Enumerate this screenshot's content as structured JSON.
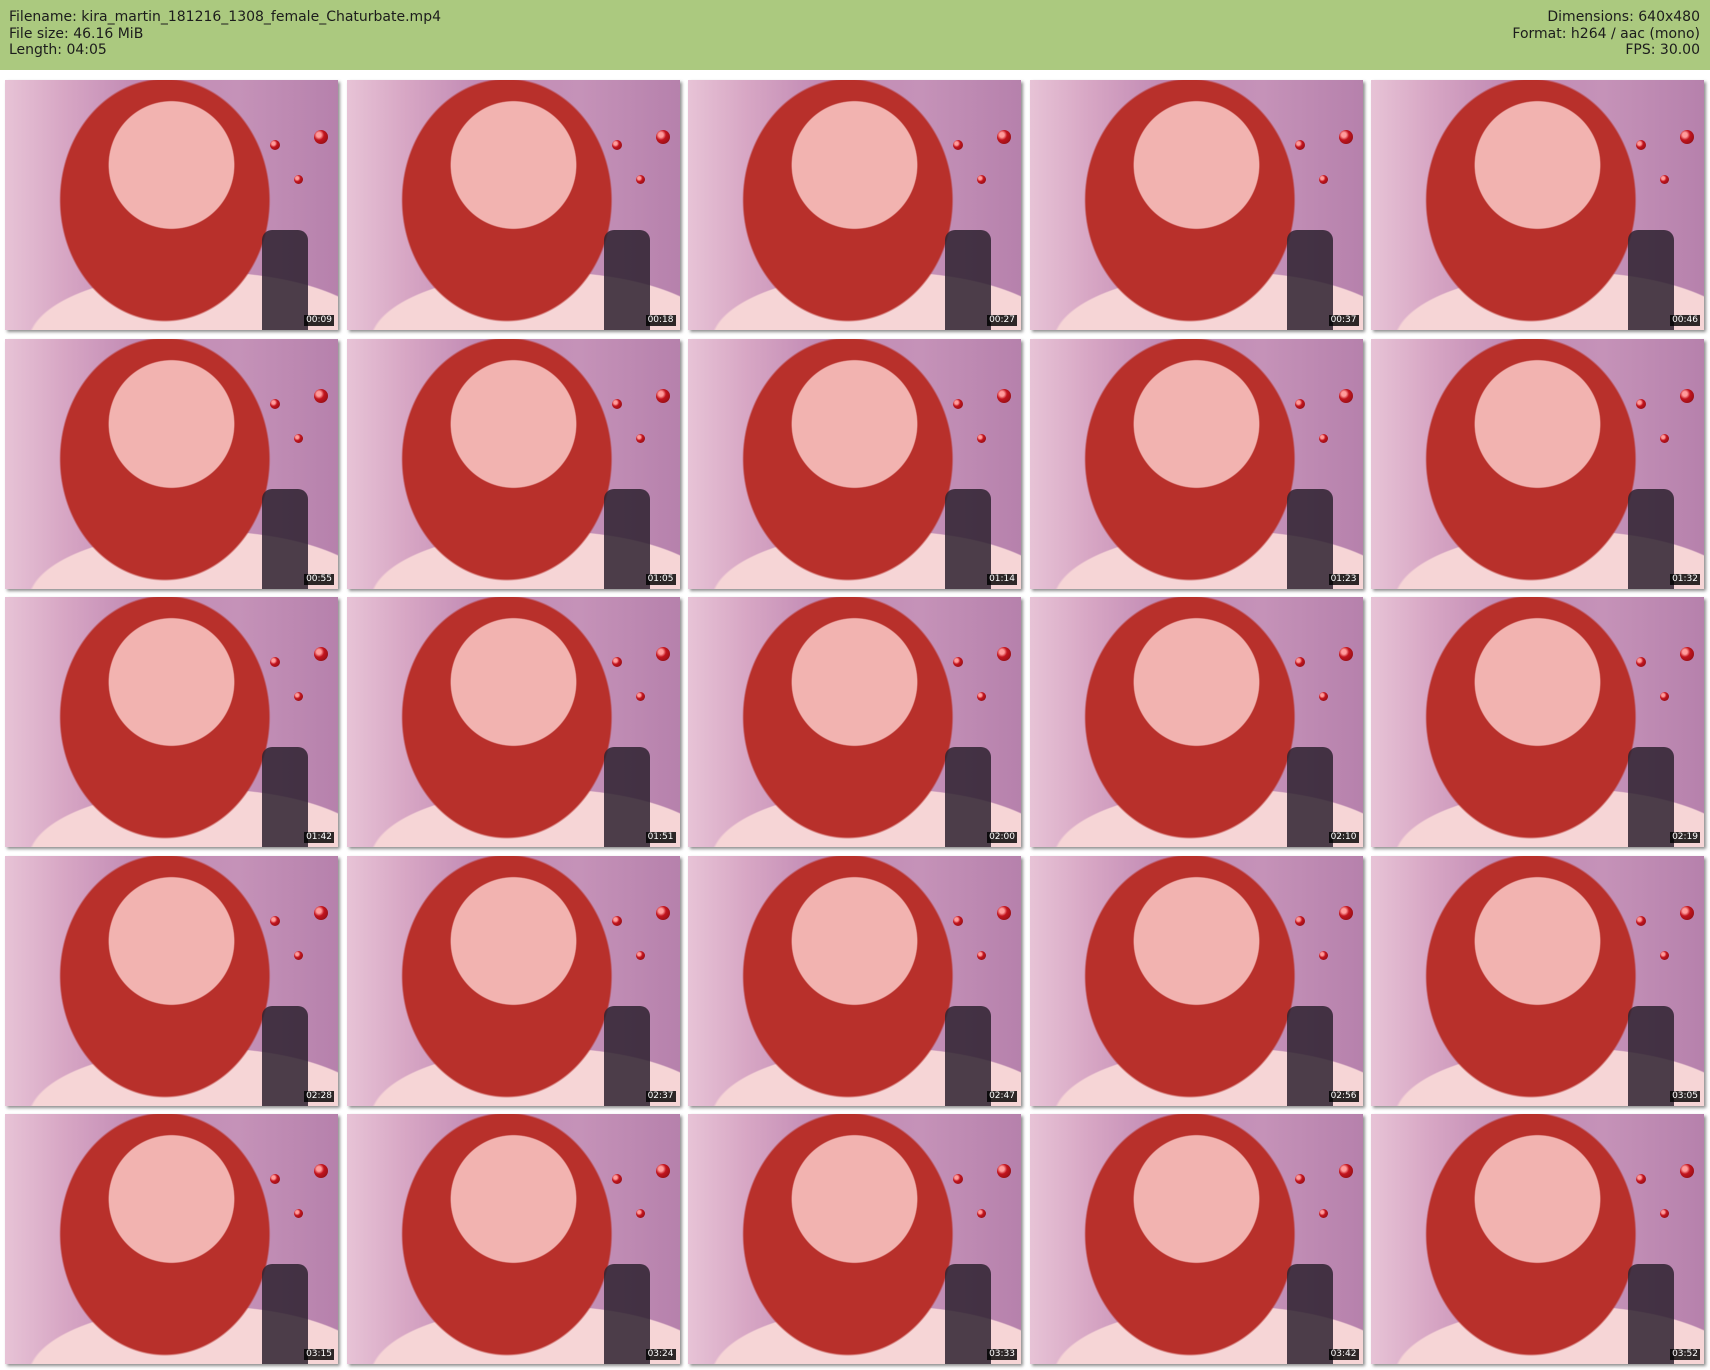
{
  "header": {
    "filename_label": "Filename: kira_martin_181216_1308_female_Chaturbate.mp4",
    "filesize_label": "File size: 46.16 MiB",
    "length_label": "Length: 04:05",
    "dimensions_label": "Dimensions: 640x480",
    "format_label": "Format: h264 / aac (mono)",
    "fps_label": "FPS: 30.00"
  },
  "colors": {
    "header_background": "#abc97f",
    "timestamp_background": "#000000",
    "timestamp_text": "#ffffff"
  },
  "thumbnails": [
    {
      "timestamp": "00:09"
    },
    {
      "timestamp": "00:18"
    },
    {
      "timestamp": "00:27"
    },
    {
      "timestamp": "00:37"
    },
    {
      "timestamp": "00:46"
    },
    {
      "timestamp": "00:55"
    },
    {
      "timestamp": "01:05"
    },
    {
      "timestamp": "01:14"
    },
    {
      "timestamp": "01:23"
    },
    {
      "timestamp": "01:32"
    },
    {
      "timestamp": "01:42"
    },
    {
      "timestamp": "01:51"
    },
    {
      "timestamp": "02:00"
    },
    {
      "timestamp": "02:10"
    },
    {
      "timestamp": "02:19"
    },
    {
      "timestamp": "02:28"
    },
    {
      "timestamp": "02:37"
    },
    {
      "timestamp": "02:47"
    },
    {
      "timestamp": "02:56"
    },
    {
      "timestamp": "03:05"
    },
    {
      "timestamp": "03:15"
    },
    {
      "timestamp": "03:24"
    },
    {
      "timestamp": "03:33"
    },
    {
      "timestamp": "03:42"
    },
    {
      "timestamp": "03:52"
    }
  ]
}
